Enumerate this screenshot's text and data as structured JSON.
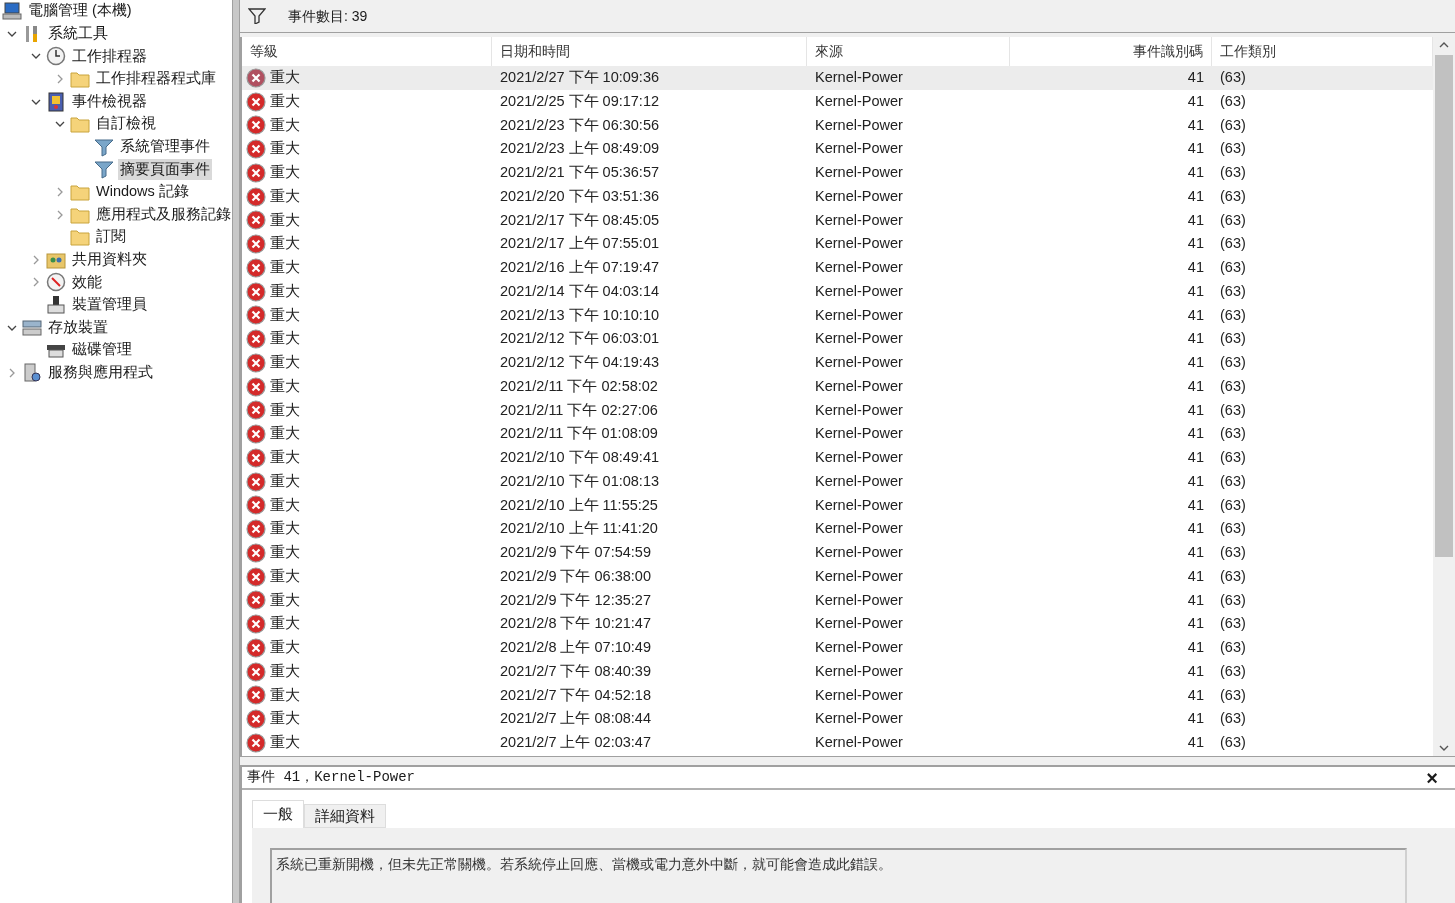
{
  "tree": [
    {
      "label": "電腦管理 (本機)",
      "kind": "computer",
      "selected": false,
      "children": [
        {
          "label": "系統工具",
          "kind": "tools",
          "expanded": true,
          "selected": false,
          "children": [
            {
              "label": "工作排程器",
              "kind": "clock",
              "expanded": true,
              "selected": false,
              "children": [
                {
                  "label": "工作排程器程式庫",
                  "kind": "folder",
                  "expanded": false,
                  "selected": false
                }
              ]
            },
            {
              "label": "事件檢視器",
              "kind": "log",
              "expanded": true,
              "selected": false,
              "children": [
                {
                  "label": "自訂檢視",
                  "kind": "folder",
                  "expanded": true,
                  "selected": false,
                  "children": [
                    {
                      "label": "系統管理事件",
                      "kind": "filter",
                      "selected": false
                    },
                    {
                      "label": "摘要頁面事件",
                      "kind": "filter",
                      "selected": true
                    }
                  ]
                },
                {
                  "label": "Windows 記錄",
                  "kind": "folder",
                  "expanded": false,
                  "selected": false
                },
                {
                  "label": "應用程式及服務記錄",
                  "kind": "folder",
                  "expanded": false,
                  "selected": false
                },
                {
                  "label": "訂閱",
                  "kind": "folder",
                  "selected": false
                }
              ]
            },
            {
              "label": "共用資料夾",
              "kind": "people",
              "expanded": false,
              "selected": false
            },
            {
              "label": "效能",
              "kind": "gauge",
              "expanded": false,
              "selected": false
            },
            {
              "label": "裝置管理員",
              "kind": "device",
              "selected": false
            }
          ]
        },
        {
          "label": "存放裝置",
          "kind": "storage",
          "expanded": true,
          "selected": false,
          "children": [
            {
              "label": "磁碟管理",
              "kind": "disk",
              "selected": false
            }
          ]
        },
        {
          "label": "服務與應用程式",
          "kind": "services",
          "expanded": false,
          "selected": false
        }
      ]
    }
  ],
  "toolbar": {
    "count_label": "事件數目: 39"
  },
  "table": {
    "columns": [
      "等級",
      "日期和時間",
      "來源",
      "事件識別碼",
      "工作類別"
    ],
    "rows": [
      {
        "level": "重大",
        "date": "2021/2/27 下午 10:09:36",
        "source": "Kernel-Power",
        "id": "41",
        "category": "(63)",
        "selected": true
      },
      {
        "level": "重大",
        "date": "2021/2/25 下午 09:17:12",
        "source": "Kernel-Power",
        "id": "41",
        "category": "(63)",
        "selected": false
      },
      {
        "level": "重大",
        "date": "2021/2/23 下午 06:30:56",
        "source": "Kernel-Power",
        "id": "41",
        "category": "(63)",
        "selected": false
      },
      {
        "level": "重大",
        "date": "2021/2/23 上午 08:49:09",
        "source": "Kernel-Power",
        "id": "41",
        "category": "(63)",
        "selected": false
      },
      {
        "level": "重大",
        "date": "2021/2/21 下午 05:36:57",
        "source": "Kernel-Power",
        "id": "41",
        "category": "(63)",
        "selected": false
      },
      {
        "level": "重大",
        "date": "2021/2/20 下午 03:51:36",
        "source": "Kernel-Power",
        "id": "41",
        "category": "(63)",
        "selected": false
      },
      {
        "level": "重大",
        "date": "2021/2/17 下午 08:45:05",
        "source": "Kernel-Power",
        "id": "41",
        "category": "(63)",
        "selected": false
      },
      {
        "level": "重大",
        "date": "2021/2/17 上午 07:55:01",
        "source": "Kernel-Power",
        "id": "41",
        "category": "(63)",
        "selected": false
      },
      {
        "level": "重大",
        "date": "2021/2/16 上午 07:19:47",
        "source": "Kernel-Power",
        "id": "41",
        "category": "(63)",
        "selected": false
      },
      {
        "level": "重大",
        "date": "2021/2/14 下午 04:03:14",
        "source": "Kernel-Power",
        "id": "41",
        "category": "(63)",
        "selected": false
      },
      {
        "level": "重大",
        "date": "2021/2/13 下午 10:10:10",
        "source": "Kernel-Power",
        "id": "41",
        "category": "(63)",
        "selected": false
      },
      {
        "level": "重大",
        "date": "2021/2/12 下午 06:03:01",
        "source": "Kernel-Power",
        "id": "41",
        "category": "(63)",
        "selected": false
      },
      {
        "level": "重大",
        "date": "2021/2/12 下午 04:19:43",
        "source": "Kernel-Power",
        "id": "41",
        "category": "(63)",
        "selected": false
      },
      {
        "level": "重大",
        "date": "2021/2/11 下午 02:58:02",
        "source": "Kernel-Power",
        "id": "41",
        "category": "(63)",
        "selected": false
      },
      {
        "level": "重大",
        "date": "2021/2/11 下午 02:27:06",
        "source": "Kernel-Power",
        "id": "41",
        "category": "(63)",
        "selected": false
      },
      {
        "level": "重大",
        "date": "2021/2/11 下午 01:08:09",
        "source": "Kernel-Power",
        "id": "41",
        "category": "(63)",
        "selected": false
      },
      {
        "level": "重大",
        "date": "2021/2/10 下午 08:49:41",
        "source": "Kernel-Power",
        "id": "41",
        "category": "(63)",
        "selected": false
      },
      {
        "level": "重大",
        "date": "2021/2/10 下午 01:08:13",
        "source": "Kernel-Power",
        "id": "41",
        "category": "(63)",
        "selected": false
      },
      {
        "level": "重大",
        "date": "2021/2/10 上午 11:55:25",
        "source": "Kernel-Power",
        "id": "41",
        "category": "(63)",
        "selected": false
      },
      {
        "level": "重大",
        "date": "2021/2/10 上午 11:41:20",
        "source": "Kernel-Power",
        "id": "41",
        "category": "(63)",
        "selected": false
      },
      {
        "level": "重大",
        "date": "2021/2/9 下午 07:54:59",
        "source": "Kernel-Power",
        "id": "41",
        "category": "(63)",
        "selected": false
      },
      {
        "level": "重大",
        "date": "2021/2/9 下午 06:38:00",
        "source": "Kernel-Power",
        "id": "41",
        "category": "(63)",
        "selected": false
      },
      {
        "level": "重大",
        "date": "2021/2/9 下午 12:35:27",
        "source": "Kernel-Power",
        "id": "41",
        "category": "(63)",
        "selected": false
      },
      {
        "level": "重大",
        "date": "2021/2/8 下午 10:21:47",
        "source": "Kernel-Power",
        "id": "41",
        "category": "(63)",
        "selected": false
      },
      {
        "level": "重大",
        "date": "2021/2/8 上午 07:10:49",
        "source": "Kernel-Power",
        "id": "41",
        "category": "(63)",
        "selected": false
      },
      {
        "level": "重大",
        "date": "2021/2/7 下午 08:40:39",
        "source": "Kernel-Power",
        "id": "41",
        "category": "(63)",
        "selected": false
      },
      {
        "level": "重大",
        "date": "2021/2/7 下午 04:52:18",
        "source": "Kernel-Power",
        "id": "41",
        "category": "(63)",
        "selected": false
      },
      {
        "level": "重大",
        "date": "2021/2/7 上午 08:08:44",
        "source": "Kernel-Power",
        "id": "41",
        "category": "(63)",
        "selected": false
      },
      {
        "level": "重大",
        "date": "2021/2/7 上午 02:03:47",
        "source": "Kernel-Power",
        "id": "41",
        "category": "(63)",
        "selected": false
      }
    ]
  },
  "detail": {
    "title": "事件 41，Kernel-Power",
    "close": "×",
    "tabs": [
      {
        "label": "一般",
        "selected": true
      },
      {
        "label": "詳細資料",
        "selected": false
      }
    ],
    "description": "系統已重新開機，但未先正常關機。若系統停止回應、當機或電力意外中斷，就可能會造成此錯誤。"
  }
}
